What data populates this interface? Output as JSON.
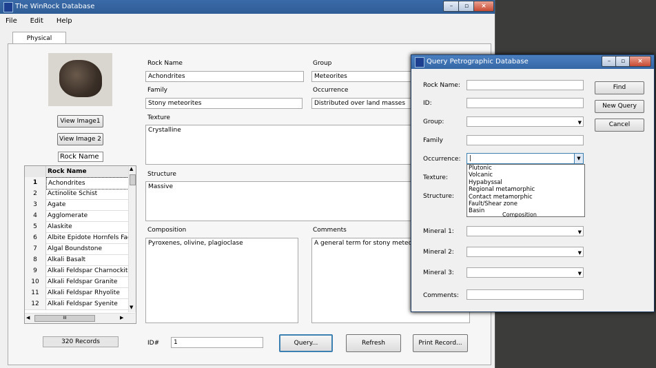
{
  "main": {
    "title": "The WinRock Database",
    "menu": [
      "File",
      "Edit",
      "Help"
    ],
    "tab": "Physical",
    "view_image1": "View Image1",
    "view_image2": "View Image 2",
    "rock_name_header": "Rock Name",
    "grid_header": "Rock Name",
    "grid_rows": [
      {
        "n": "1",
        "name": "Achondrites"
      },
      {
        "n": "2",
        "name": "Actinolite Schist"
      },
      {
        "n": "3",
        "name": "Agate"
      },
      {
        "n": "4",
        "name": "Agglomerate"
      },
      {
        "n": "5",
        "name": "Alaskite"
      },
      {
        "n": "6",
        "name": "Albite Epidote Hornfels Facies"
      },
      {
        "n": "7",
        "name": "Algal Boundstone"
      },
      {
        "n": "8",
        "name": "Alkali Basalt"
      },
      {
        "n": "9",
        "name": "Alkali Feldspar Charnockite"
      },
      {
        "n": "10",
        "name": "Alkali Feldspar Granite"
      },
      {
        "n": "11",
        "name": "Alkali Feldspar Rhyolite"
      },
      {
        "n": "12",
        "name": "Alkali Feldspar Syenite"
      }
    ],
    "records": "320 Records",
    "fields": {
      "rock_name_label": "Rock Name",
      "rock_name": "Achondrites",
      "group_label": "Group",
      "group": "Meteorites",
      "family_label": "Family",
      "family": "Stony meteorites",
      "occurrence_label": "Occurrence",
      "occurrence": "Distributed over land masses",
      "texture_label": "Texture",
      "texture": "Crystalline",
      "structure_label": "Structure",
      "structure": "Massive",
      "composition_label": "Composition",
      "composition": "Pyroxenes, olivine, plagioclase",
      "comments_label": "Comments",
      "comments": "A general term for stony meteorites wi",
      "id_label": "ID#",
      "id": "1"
    },
    "buttons": {
      "query": "Query...",
      "refresh": "Refresh",
      "print": "Print Record..."
    }
  },
  "dialog": {
    "title": "Query Petrographic Database",
    "labels": {
      "rock_name": "Rock Name:",
      "id": "ID:",
      "group": "Group:",
      "family": "Family",
      "occurrence": "Occurrence:",
      "texture": "Texture:",
      "structure": "Structure:",
      "composition": "Composition",
      "mineral1": "Mineral 1:",
      "mineral2": "Mineral 2:",
      "mineral3": "Mineral 3:",
      "comments": "Comments:"
    },
    "buttons": {
      "find": "Find",
      "new_query": "New Query",
      "cancel": "Cancel"
    },
    "occurrence_options": [
      "Plutonic",
      "Volcanic",
      "Hypabyssal",
      "Regional metamorphic",
      "Contact metamorphic",
      "Fault/Shear zone",
      "Basin"
    ]
  }
}
